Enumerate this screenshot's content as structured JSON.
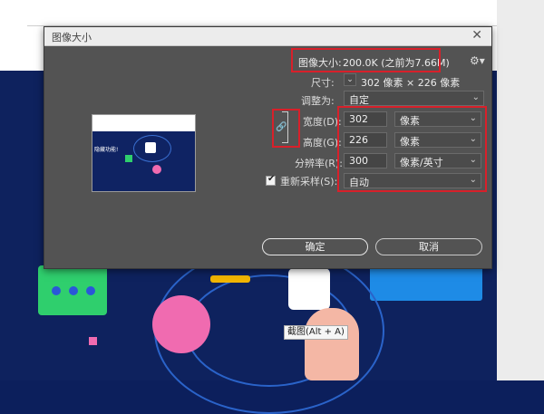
{
  "dialog": {
    "title": "图像大小",
    "close_icon": "close-icon",
    "image_size_label": "图像大小:",
    "image_size_value": "200.0K (之前为7.66M)",
    "dimensions_label": "尺寸:",
    "dimensions_value": "302 像素 × 226 像素",
    "fit_to_label": "调整为:",
    "fit_to_value": "自定",
    "width_label": "宽度(D):",
    "width_value": "302",
    "width_unit": "像素",
    "height_label": "高度(G):",
    "height_value": "226",
    "height_unit": "像素",
    "resolution_label": "分辨率(R):",
    "resolution_value": "300",
    "resolution_unit": "像素/英寸",
    "resample_label": "重新采样(S):",
    "resample_checked": true,
    "resample_value": "自动",
    "ok_label": "确定",
    "cancel_label": "取消"
  },
  "preview": {
    "text": "隐藏功能!"
  },
  "tooltip": {
    "text": "截图(Alt + A)"
  },
  "colors": {
    "highlight": "#d8202a",
    "dialog_bg": "#535353",
    "background_blue": "#0e225e"
  }
}
